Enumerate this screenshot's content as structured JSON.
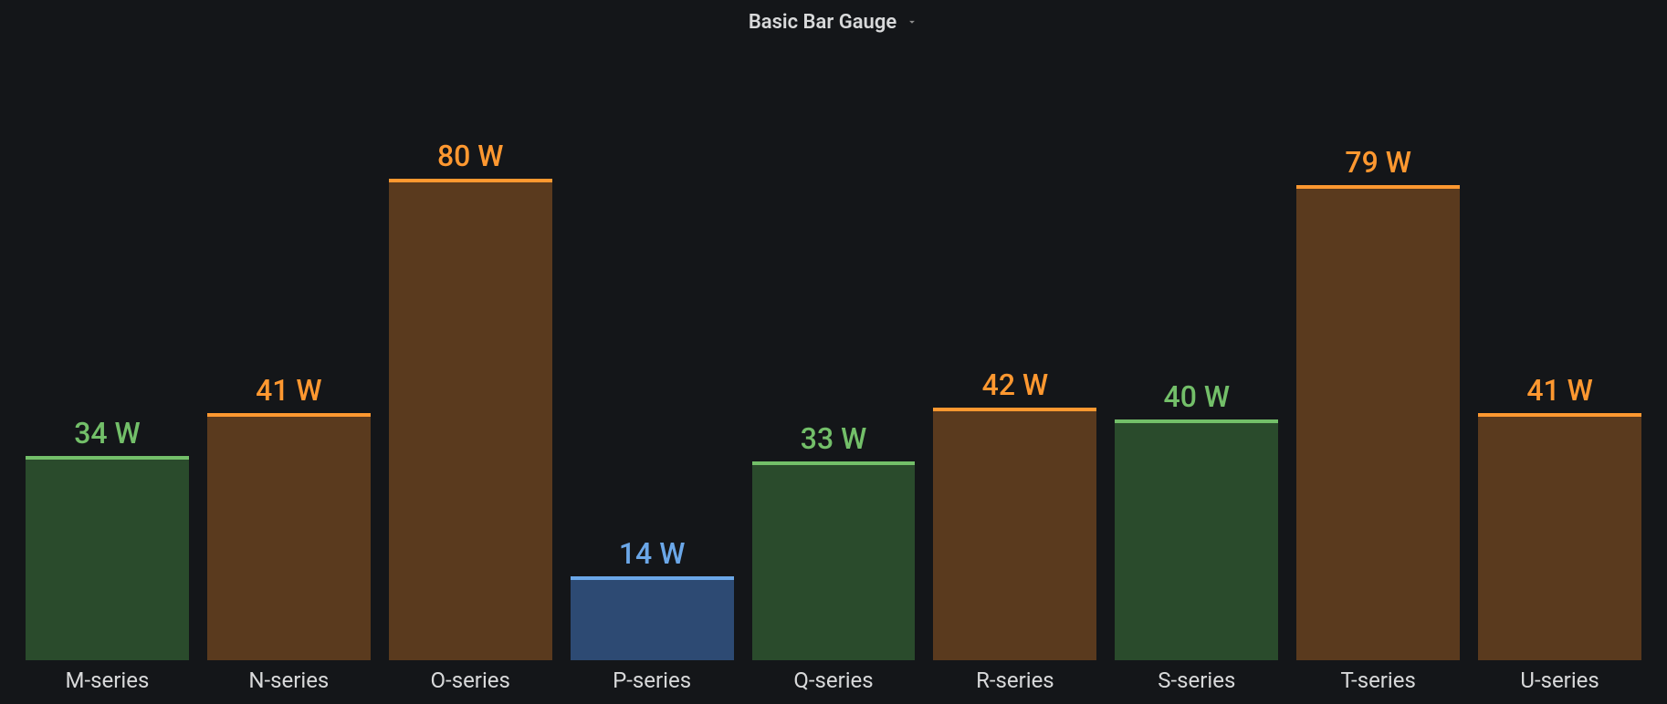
{
  "panel": {
    "title": "Basic Bar Gauge"
  },
  "chart_data": {
    "type": "bar",
    "unit": "W",
    "max": 100,
    "categories": [
      "M-series",
      "N-series",
      "O-series",
      "P-series",
      "Q-series",
      "R-series",
      "S-series",
      "T-series",
      "U-series"
    ],
    "values": [
      34,
      41,
      80,
      14,
      33,
      42,
      40,
      79,
      41
    ],
    "value_labels": [
      "34 W",
      "41 W",
      "80 W",
      "14 W",
      "33 W",
      "42 W",
      "40 W",
      "79 W",
      "41 W"
    ],
    "thresholds": [
      {
        "upto": 20,
        "label_color": "#6ba7e8",
        "fill_color": "#2d4a73",
        "top_color": "#6ba7e8"
      },
      {
        "upto": 40,
        "label_color": "#73bf69",
        "fill_color": "#2a4b2c",
        "top_color": "#73bf69"
      },
      {
        "upto": 1000000,
        "label_color": "#ff9830",
        "fill_color": "#5a3a1e",
        "top_color": "#ff9830"
      }
    ]
  }
}
